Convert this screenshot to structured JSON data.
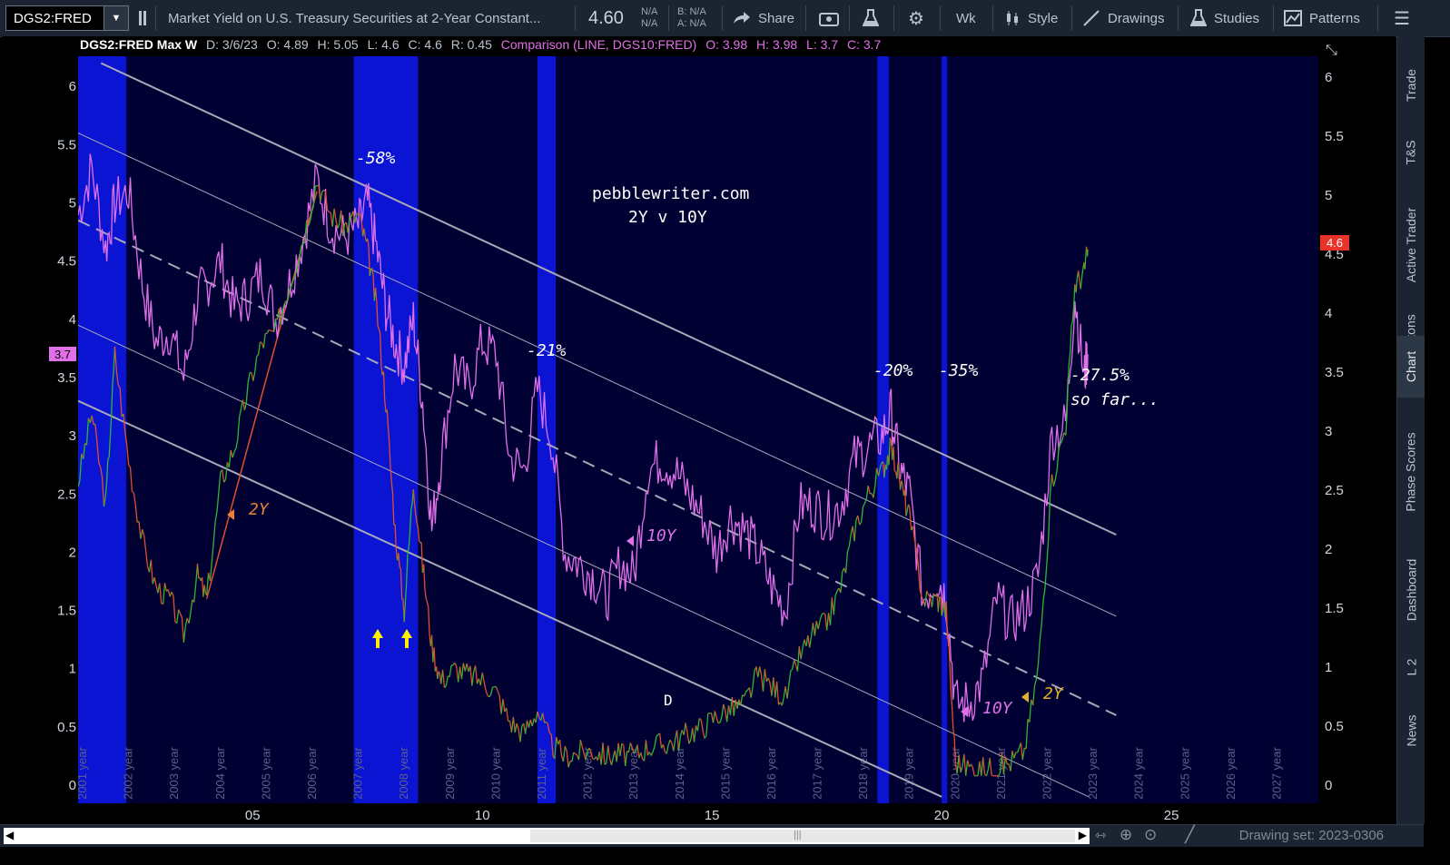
{
  "toolbar": {
    "symbol": "DGS2:FRED",
    "description": "Market Yield on U.S. Treasury Securities at 2-Year Constant...",
    "last": "4.60",
    "na1": "N/A",
    "na2": "N/A",
    "bid": "B: N/A",
    "ask": "A: N/A",
    "share": "Share",
    "aggregation": "Wk",
    "style": "Style",
    "drawings": "Drawings",
    "studies": "Studies",
    "patterns": "Patterns"
  },
  "header": {
    "title": "DGS2:FRED Max W",
    "d": "D: 3/6/23",
    "o": "O: 4.89",
    "h": "H: 5.05",
    "l": "L: 4.6",
    "c": "C: 4.6",
    "r": "R: 0.45",
    "comparison": "Comparison (LINE, DGS10:FRED)",
    "co": "O: 3.98",
    "ch": "H: 3.98",
    "cl": "L: 3.7",
    "cc": "C: 3.7"
  },
  "side_tabs": [
    "Trade",
    "T&S",
    "Active Trader",
    "Buttons",
    "Chart",
    "Phase Scores",
    "Dashboard",
    "L 2",
    "News"
  ],
  "drawing_set": "Drawing set: 2023-0306",
  "colors": {
    "background": "#000033",
    "recession": "#0a14d2",
    "two_year_up": "#2fb82f",
    "two_year_down": "#e0502a",
    "ten_year": "#e070e8",
    "channel": "#a8a8b8",
    "annotation": "#ffffff",
    "label_2y": "#e8823a",
    "label_2y_late": "#e0b030",
    "arrow": "#ffee00"
  },
  "annotations": {
    "site": "pebblewriter.com",
    "subtitle": "2Y v 10Y",
    "a58": "-58%",
    "a21": "-21%",
    "a20": "-20%",
    "a35": "-35%",
    "a275": "-27.5%",
    "sofar": "so far...",
    "lbl2y": "2Y",
    "lbl10y": "10Y",
    "lbl10y_b": "10Y",
    "lbl2y_b": "2Y",
    "d": "D"
  },
  "price_badges": {
    "left": "3.7",
    "right": "4.6"
  },
  "chart_data": {
    "type": "line",
    "x_axis": {
      "min": 2001.2,
      "max": 2028.2,
      "ticks": [
        2005,
        2010,
        2015,
        2020,
        2025
      ],
      "tick_labels": [
        "05",
        "10",
        "15",
        "20",
        "25"
      ]
    },
    "year_labels": [
      "2001 year",
      "2002 year",
      "2003 year",
      "2004 year",
      "2005 year",
      "2006 year",
      "2007 year",
      "2008 year",
      "2009 year",
      "2010 year",
      "2011 year",
      "2012 year",
      "2013 year",
      "2014 year",
      "2015 year",
      "2016 year",
      "2017 year",
      "2018 year",
      "2019 year",
      "2020 year",
      "2021 year",
      "2022 year",
      "2023 year",
      "2024 year",
      "2025 year",
      "2026 year",
      "2027 year"
    ],
    "y_left": {
      "min": 0,
      "max": 6,
      "ticks": [
        0,
        0.5,
        1,
        1.5,
        2,
        2.5,
        3,
        3.5,
        4,
        4.5,
        5,
        5.5,
        6
      ],
      "tick_labels": [
        "0",
        "0.5",
        "1",
        "1.5",
        "2",
        "2.5",
        "3",
        "3.5",
        "4",
        "4.5",
        "5",
        "5.5",
        "6"
      ]
    },
    "y_right": {
      "min": 0,
      "max": 6,
      "ticks": [
        0,
        0.5,
        1,
        1.5,
        2,
        2.5,
        3,
        3.5,
        4,
        4.5,
        5,
        5.5,
        6
      ],
      "tick_labels": [
        "0",
        "0.5",
        "1",
        "1.5",
        "2",
        "2.5",
        "3",
        "3.5",
        "4",
        "4.5",
        "5",
        "5.5",
        "6"
      ]
    },
    "recessions": [
      [
        2001.2,
        2002.25
      ],
      [
        2007.2,
        2008.6
      ],
      [
        2011.2,
        2011.6
      ],
      [
        2018.6,
        2018.85
      ],
      [
        2020.0,
        2020.12
      ]
    ],
    "series": [
      {
        "name": "2Y",
        "x": [
          2001.2,
          2001.5,
          2001.8,
          2002.0,
          2002.3,
          2002.6,
          2002.9,
          2003.2,
          2003.5,
          2003.8,
          2004.0,
          2004.3,
          2004.6,
          2004.9,
          2005.2,
          2005.5,
          2005.8,
          2006.1,
          2006.4,
          2006.7,
          2007.0,
          2007.3,
          2007.5,
          2007.7,
          2007.9,
          2008.1,
          2008.3,
          2008.5,
          2008.7,
          2008.9,
          2009.1,
          2009.4,
          2009.7,
          2010.0,
          2010.3,
          2010.6,
          2010.9,
          2011.2,
          2011.5,
          2011.8,
          2012.1,
          2012.4,
          2012.7,
          2013.0,
          2013.3,
          2013.6,
          2013.9,
          2014.2,
          2014.5,
          2014.8,
          2015.1,
          2015.4,
          2015.7,
          2016.0,
          2016.3,
          2016.6,
          2016.9,
          2017.2,
          2017.5,
          2017.8,
          2018.1,
          2018.4,
          2018.7,
          2018.9,
          2019.1,
          2019.3,
          2019.6,
          2019.9,
          2020.1,
          2020.3,
          2020.6,
          2020.9,
          2021.2,
          2021.5,
          2021.8,
          2022.1,
          2022.4,
          2022.7,
          2022.9,
          2023.1,
          2023.18
        ],
        "y": [
          2.6,
          3.2,
          2.4,
          3.7,
          2.8,
          2.1,
          1.7,
          1.6,
          1.3,
          1.8,
          1.6,
          2.6,
          2.9,
          3.4,
          3.8,
          3.9,
          4.3,
          4.7,
          5.2,
          4.9,
          4.8,
          4.9,
          4.6,
          4.1,
          3.3,
          2.2,
          1.5,
          2.6,
          1.9,
          1.2,
          0.9,
          1.0,
          0.95,
          0.9,
          0.8,
          0.55,
          0.45,
          0.65,
          0.35,
          0.25,
          0.28,
          0.3,
          0.25,
          0.27,
          0.25,
          0.33,
          0.35,
          0.38,
          0.45,
          0.5,
          0.6,
          0.65,
          0.7,
          0.95,
          0.85,
          0.75,
          1.1,
          1.3,
          1.4,
          1.7,
          2.2,
          2.5,
          2.7,
          2.9,
          2.6,
          2.3,
          1.6,
          1.6,
          1.5,
          0.2,
          0.15,
          0.14,
          0.15,
          0.2,
          0.3,
          1.0,
          2.6,
          3.1,
          4.3,
          4.4,
          4.6
        ]
      },
      {
        "name": "10Y",
        "x": [
          2001.2,
          2001.5,
          2001.8,
          2002.0,
          2002.3,
          2002.6,
          2002.9,
          2003.2,
          2003.5,
          2003.8,
          2004.0,
          2004.3,
          2004.6,
          2004.9,
          2005.2,
          2005.5,
          2005.8,
          2006.1,
          2006.4,
          2006.7,
          2007.0,
          2007.3,
          2007.5,
          2007.7,
          2007.9,
          2008.1,
          2008.3,
          2008.5,
          2008.7,
          2008.9,
          2009.1,
          2009.4,
          2009.7,
          2010.0,
          2010.3,
          2010.6,
          2010.9,
          2011.2,
          2011.5,
          2011.8,
          2012.1,
          2012.4,
          2012.7,
          2013.0,
          2013.3,
          2013.6,
          2013.9,
          2014.2,
          2014.5,
          2014.8,
          2015.1,
          2015.4,
          2015.7,
          2016.0,
          2016.3,
          2016.6,
          2016.9,
          2017.2,
          2017.5,
          2017.8,
          2018.1,
          2018.4,
          2018.7,
          2018.9,
          2019.1,
          2019.3,
          2019.6,
          2019.9,
          2020.1,
          2020.3,
          2020.6,
          2020.9,
          2021.2,
          2021.5,
          2021.8,
          2022.1,
          2022.4,
          2022.7,
          2022.9,
          2023.1,
          2023.18
        ],
        "y": [
          4.9,
          5.3,
          4.6,
          5.0,
          5.1,
          4.3,
          3.8,
          3.9,
          3.5,
          4.2,
          4.3,
          4.5,
          4.1,
          4.2,
          4.4,
          4.0,
          4.3,
          4.7,
          5.2,
          4.8,
          4.7,
          4.8,
          5.0,
          4.6,
          4.1,
          3.8,
          3.6,
          4.0,
          3.3,
          2.2,
          2.8,
          3.6,
          3.4,
          3.8,
          3.7,
          2.8,
          2.7,
          3.4,
          3.0,
          2.0,
          1.9,
          1.8,
          1.6,
          1.9,
          1.8,
          2.7,
          2.8,
          2.7,
          2.5,
          2.3,
          2.0,
          2.3,
          2.2,
          2.0,
          1.7,
          1.5,
          2.4,
          2.4,
          2.3,
          2.4,
          2.8,
          2.9,
          3.0,
          3.2,
          2.7,
          2.5,
          1.6,
          1.8,
          1.6,
          0.7,
          0.7,
          0.9,
          1.6,
          1.4,
          1.5,
          1.8,
          3.0,
          3.1,
          4.2,
          3.5,
          3.7
        ]
      }
    ],
    "channel_lines": [
      {
        "style": "solid",
        "points": [
          [
            2001.7,
            6.2
          ],
          [
            2023.8,
            2.15
          ]
        ]
      },
      {
        "style": "thin",
        "points": [
          [
            2001.2,
            5.6
          ],
          [
            2023.8,
            1.45
          ]
        ]
      },
      {
        "style": "dashed",
        "points": [
          [
            2001.2,
            4.85
          ],
          [
            2023.8,
            0.6
          ]
        ]
      },
      {
        "style": "thin",
        "points": [
          [
            2001.2,
            3.95
          ],
          [
            2023.2,
            -0.1
          ]
        ]
      },
      {
        "style": "solid",
        "points": [
          [
            2001.2,
            3.3
          ],
          [
            2020.0,
            -0.1
          ]
        ]
      },
      {
        "style": "orange",
        "points": [
          [
            2004.0,
            1.6
          ],
          [
            2006.4,
            5.1
          ]
        ]
      }
    ]
  }
}
